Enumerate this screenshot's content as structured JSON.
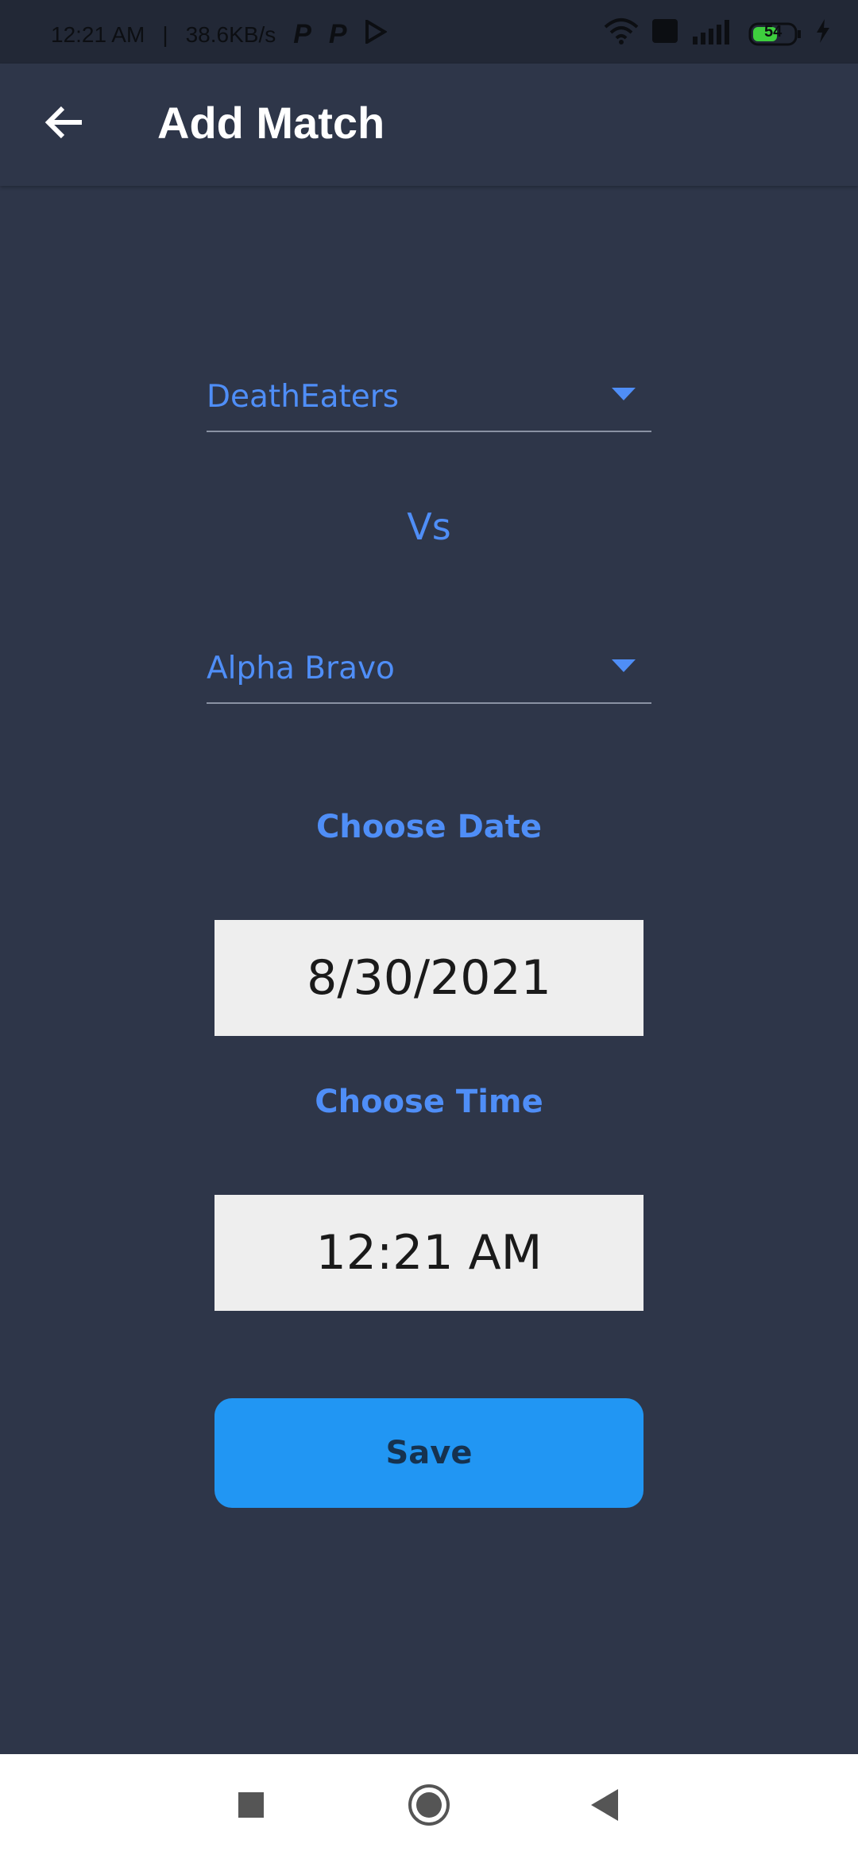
{
  "status_bar": {
    "time": "12:21 AM",
    "separator": "|",
    "speed": "38.6KB/s",
    "notif_p1": "P",
    "notif_p2": "P",
    "battery": "54"
  },
  "app_bar": {
    "title": "Add Match",
    "back_icon": "arrow-left-icon"
  },
  "form": {
    "team1": {
      "selected": "DeathEaters"
    },
    "vs_label": "Vs",
    "team2": {
      "selected": "Alpha Bravo"
    },
    "date_label": "Choose Date",
    "date_value": "8/30/2021",
    "time_label": "Choose Time",
    "time_value": "12:21 AM",
    "save_label": "Save"
  },
  "nav_bar": {
    "icons": [
      "square-icon",
      "circle-home-icon",
      "triangle-back-icon"
    ]
  },
  "colors": {
    "background": "#2e3649",
    "accent": "#4f8ef7",
    "button": "#2196f3"
  }
}
